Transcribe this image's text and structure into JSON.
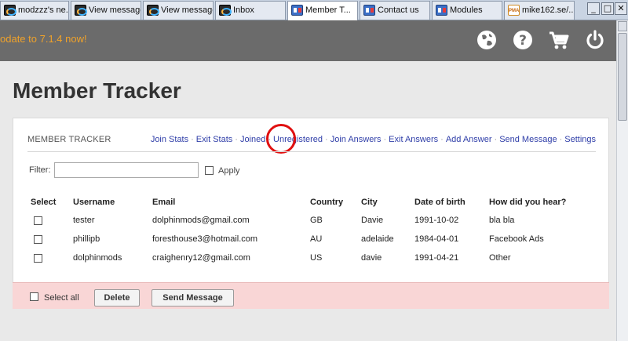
{
  "browser": {
    "tabs": [
      {
        "label": "modzzz's ne...",
        "icon": "dolphin-icon"
      },
      {
        "label": "View message",
        "icon": "dolphin-icon"
      },
      {
        "label": "View message",
        "icon": "dolphin-icon"
      },
      {
        "label": "Inbox",
        "icon": "dolphin-icon"
      },
      {
        "label": "Member T...",
        "icon": "modules-icon"
      },
      {
        "label": "Contact us",
        "icon": "modules-icon"
      },
      {
        "label": "Modules",
        "icon": "modules-icon"
      },
      {
        "label": "mike162.se/...",
        "icon": "phpmyadmin-icon"
      }
    ],
    "window_buttons": [
      "_",
      "□",
      "✕"
    ]
  },
  "header": {
    "update_text": "odate to 7.1.4 now!",
    "icons": [
      "globe-icon",
      "help-icon",
      "cart-icon",
      "power-icon"
    ],
    "background": "#6b6b6b",
    "update_color": "#f0a22a"
  },
  "page": {
    "title": "Member Tracker"
  },
  "card": {
    "heading": "MEMBER TRACKER",
    "nav": [
      "Join Stats",
      "Exit Stats",
      "Joined",
      "Unregistered",
      "Join Answers",
      "Exit Answers",
      "Add Answer",
      "Send Message",
      "Settings"
    ],
    "nav_color": "#2f3ea8",
    "highlight_color": "#e01010",
    "filter_label": "Filter:",
    "filter_value": "",
    "apply_label": "Apply",
    "columns": [
      "Select",
      "Username",
      "Email",
      "Country",
      "City",
      "Date of birth",
      "How did you hear?"
    ],
    "rows": [
      {
        "username": "tester",
        "email": "dolphinmods@gmail.com",
        "country": "GB",
        "city": "Davie",
        "dob": "1991-10-02",
        "heard": "bla bla"
      },
      {
        "username": "phillipb",
        "email": "foresthouse3@hotmail.com",
        "country": "AU",
        "city": "adelaide",
        "dob": "1984-04-01",
        "heard": "Facebook Ads"
      },
      {
        "username": "dolphinmods",
        "email": "craighenry12@gmail.com",
        "country": "US",
        "city": "davie",
        "dob": "1991-04-21",
        "heard": "Other"
      }
    ]
  },
  "footer": {
    "select_all_label": "Select all",
    "delete_label": "Delete",
    "send_label": "Send Message",
    "background": "#f9d6d6"
  }
}
